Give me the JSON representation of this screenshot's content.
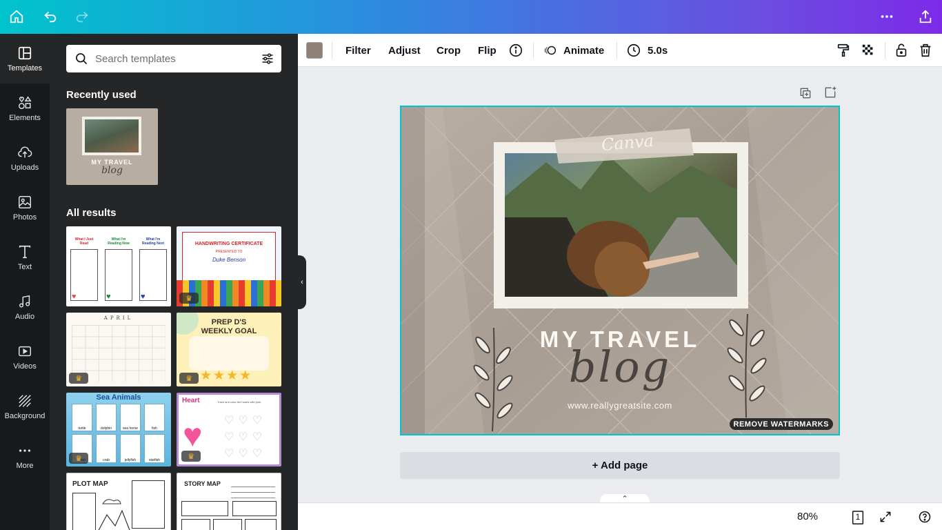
{
  "topbar": {
    "home_icon": "home-icon",
    "undo_icon": "undo-icon",
    "redo_icon": "redo-icon",
    "more_icon": "more-horizontal-icon",
    "share_icon": "upload-icon"
  },
  "rail": {
    "items": [
      {
        "label": "Templates",
        "icon": "templates-icon"
      },
      {
        "label": "Elements",
        "icon": "elements-icon"
      },
      {
        "label": "Uploads",
        "icon": "upload-cloud-icon"
      },
      {
        "label": "Photos",
        "icon": "image-icon"
      },
      {
        "label": "Text",
        "icon": "text-icon"
      },
      {
        "label": "Audio",
        "icon": "music-note-icon"
      },
      {
        "label": "Videos",
        "icon": "video-icon"
      },
      {
        "label": "Background",
        "icon": "background-icon"
      },
      {
        "label": "More",
        "icon": "more-icon"
      }
    ]
  },
  "panel": {
    "search_placeholder": "Search templates",
    "recently_used": "Recently used",
    "all_results": "All results",
    "recent_thumb": {
      "title": "MY TRAVEL",
      "script": "blog"
    },
    "templates": [
      {
        "name": "reading-chart",
        "headers": [
          "What I Just Read",
          "What I'm Reading Now",
          "What I'm Reading Next"
        ]
      },
      {
        "name": "handwriting-certificate",
        "title": "HANDWRITING CERTIFICATE",
        "subtitle": "PRESENTED TO",
        "recipient": "Duke Benson"
      },
      {
        "name": "april-calendar",
        "title": "APRIL"
      },
      {
        "name": "weekly-goal",
        "title": "PREP D'S WEEKLY GOAL"
      },
      {
        "name": "sea-animals",
        "title": "Sea Animals",
        "animals": [
          "turtle",
          "dolphin",
          "sea horse",
          "fish",
          "crab",
          "crab",
          "jellyfish",
          "starfish"
        ]
      },
      {
        "name": "heart-worksheet",
        "title": "Heart",
        "instruction": "Trace and color the hearts with pink."
      },
      {
        "name": "plot-map",
        "title": "PLOT MAP"
      },
      {
        "name": "story-map",
        "title": "STORY MAP"
      }
    ]
  },
  "toolbar": {
    "color_swatch": "#8f8177",
    "filter": "Filter",
    "adjust": "Adjust",
    "crop": "Crop",
    "flip": "Flip",
    "animate": "Animate",
    "duration": "5.0s"
  },
  "canvas": {
    "canva_tape": "Canva",
    "title": "MY TRAVEL",
    "script": "blog",
    "website": "www.reallygreatsite.com",
    "watermark": "REMOVE WATERMARKS",
    "add_page": "+ Add page"
  },
  "bottombar": {
    "zoom": "80%",
    "page_count": "1"
  }
}
